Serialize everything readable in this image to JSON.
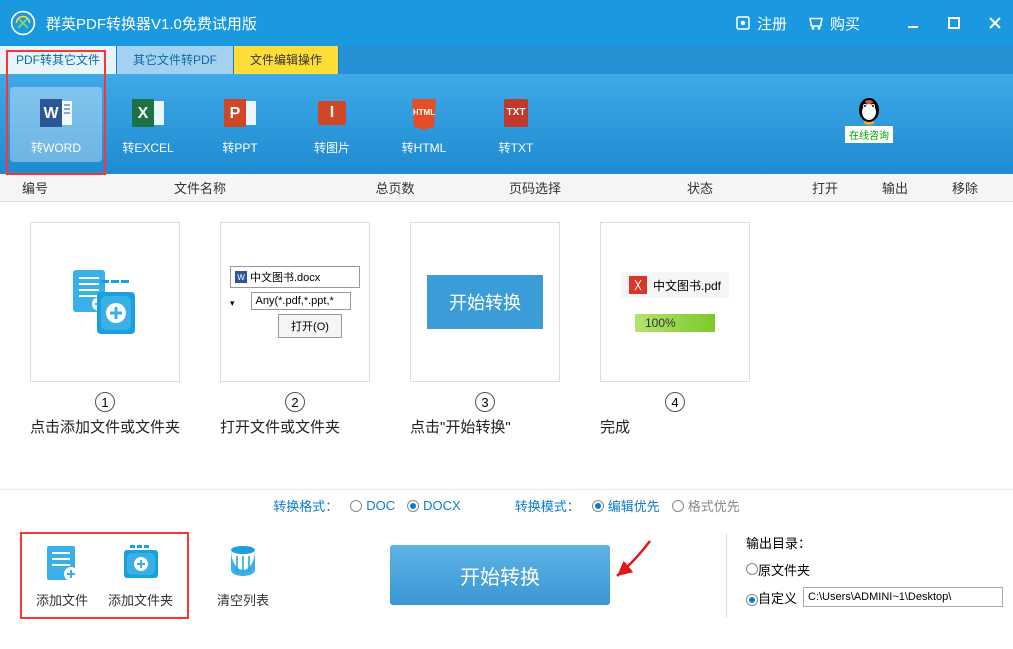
{
  "titlebar": {
    "title": "群英PDF转换器V1.0免费试用版",
    "register": "注册",
    "buy": "购买"
  },
  "tabs": {
    "t1": "PDF转其它文件",
    "t2": "其它文件转PDF",
    "t3": "文件编辑操作"
  },
  "toolbar": {
    "word": "转WORD",
    "excel": "转EXCEL",
    "ppt": "转PPT",
    "img": "转图片",
    "html": "转HTML",
    "txt": "转TXT",
    "qq": "在线咨询"
  },
  "headers": {
    "seq": "编号",
    "name": "文件名称",
    "pages": "总页数",
    "pagesel": "页码选择",
    "status": "状态",
    "open": "打开",
    "output": "输出",
    "remove": "移除"
  },
  "steps": {
    "s1": {
      "num": "1",
      "label": "点击添加文件或文件夹"
    },
    "s2": {
      "num": "2",
      "label": "打开文件或文件夹",
      "filename": "中文图书.docx",
      "filter": "Any(*.pdf,*.ppt,*",
      "openbtn": "打开(O)"
    },
    "s3": {
      "num": "3",
      "label": "点击\"开始转换\"",
      "btntext": "开始转换"
    },
    "s4": {
      "num": "4",
      "label": "完成",
      "pdfname": "中文图书.pdf",
      "progress": "100%"
    }
  },
  "options": {
    "formatLabel": "转换格式：",
    "doc": "DOC",
    "docx": "DOCX",
    "modeLabel": "转换模式：",
    "editFirst": "编辑优先",
    "formatFirst": "格式优先"
  },
  "footer": {
    "addFile": "添加文件",
    "addFolder": "添加文件夹",
    "clearList": "清空列表",
    "convert": "开始转换",
    "outputDir": "输出目录：",
    "srcFolder": "原文件夹",
    "custom": "自定义",
    "path": "C:\\Users\\ADMINI~1\\Desktop\\"
  }
}
